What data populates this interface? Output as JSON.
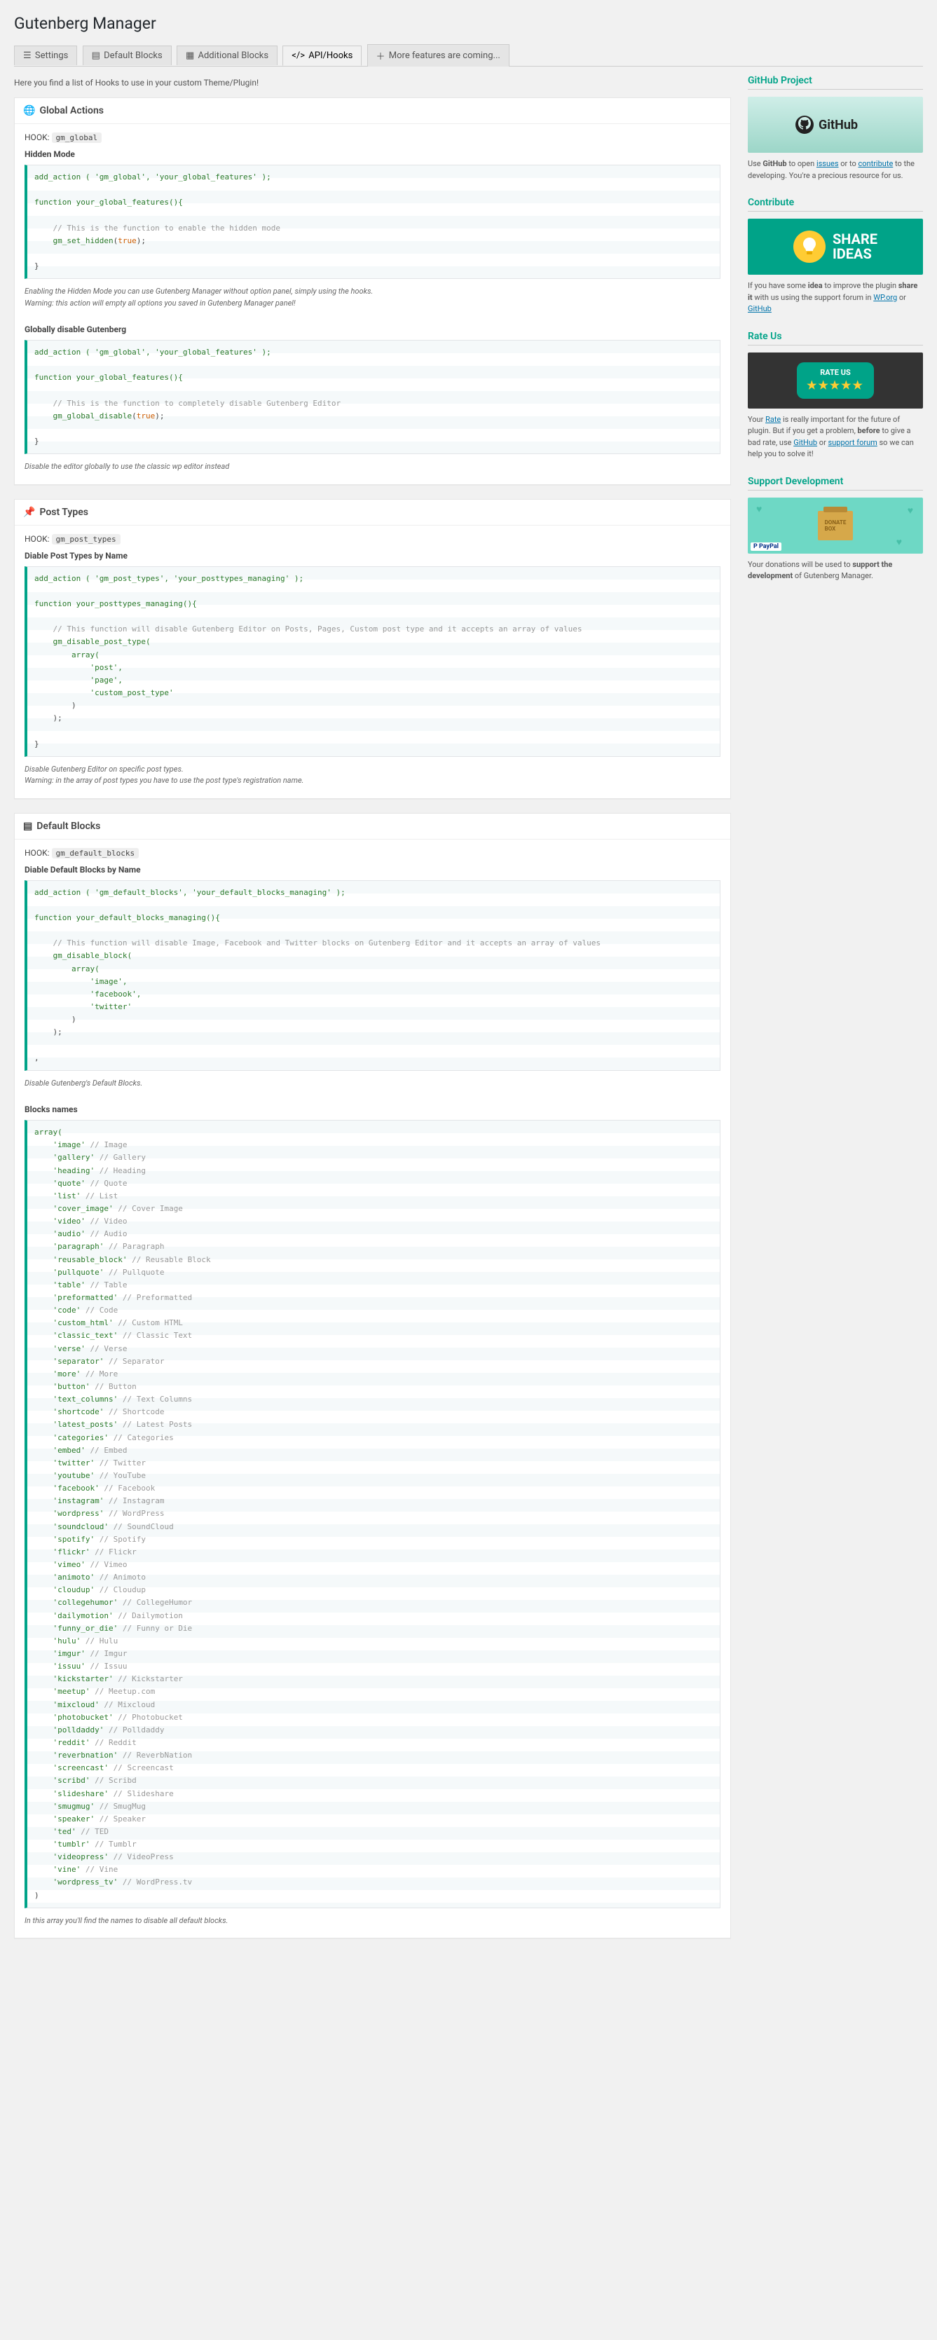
{
  "page": {
    "title": "Gutenberg Manager"
  },
  "tabs": [
    {
      "label": "Settings"
    },
    {
      "label": "Default Blocks"
    },
    {
      "label": "Additional Blocks"
    },
    {
      "label": "API/Hooks"
    },
    {
      "label": "More features are coming..."
    }
  ],
  "intro": "Here you find a list of Hooks to use in your custom Theme/Plugin!",
  "sections": {
    "global": {
      "heading": "Global Actions",
      "hook_prefix": "HOOK:",
      "hook": "gm_global",
      "sub1": "Hidden Mode",
      "note1a": "Enabling the Hidden Mode you can use Gutenberg Manager without option panel, simply using the hooks.",
      "note1b": "Warning: this action will empty all options you saved in Gutenberg Manager panel!",
      "sub2": "Globally disable Gutenberg",
      "note2": "Disable the editor globally to use the classic wp editor instead"
    },
    "post_types": {
      "heading": "Post Types",
      "hook_prefix": "HOOK:",
      "hook": "gm_post_types",
      "sub1": "Diable Post Types by Name",
      "note1a": "Disable Gutenberg Editor on specific post types.",
      "note1b": "Warning: in the array of post types you have to use the post type's registration name."
    },
    "default_blocks": {
      "heading": "Default Blocks",
      "hook_prefix": "HOOK:",
      "hook": "gm_default_blocks",
      "sub1": "Diable Default Blocks by Name",
      "note1": "Disable Gutenberg's Default Blocks.",
      "sub2": "Blocks names",
      "note2": "In this array you'll find the names to disable all default blocks."
    }
  },
  "code": {
    "global_hidden_add": "add_action ( 'gm_global', 'your_global_features' );",
    "global_hidden_fn_open": "function your_global_features(){",
    "global_hidden_cmt": "    // This is the function to enable the hidden mode",
    "global_hidden_call": "    gm_set_hidden(true);",
    "close_brace": "}",
    "global_disable_add": "add_action ( 'gm_global', 'your_global_features' );",
    "global_disable_fn_open": "function your_global_features(){",
    "global_disable_cmt": "    // This is the function to completely disable Gutenberg Editor",
    "global_disable_call": "    gm_global_disable(true);",
    "pt_add": "add_action ( 'gm_post_types', 'your_posttypes_managing' );",
    "pt_fn_open": "function your_posttypes_managing(){",
    "pt_cmt": "    // This function will disable Gutenberg Editor on Posts, Pages, Custom post type and it accepts an array of values",
    "pt_call_open": "    gm_disable_post_type(",
    "pt_array_open": "        array(",
    "pt_item1": "            'post',",
    "pt_item2": "            'page',",
    "pt_item3": "            'custom_post_type'",
    "pt_array_close": "        )",
    "pt_call_close": "    );",
    "db_add": "add_action ( 'gm_default_blocks', 'your_default_blocks_managing' );",
    "db_fn_open": "function your_default_blocks_managing(){",
    "db_cmt": "    // This function will disable Image, Facebook and Twitter blocks on Gutenberg Editor and it accepts an array of values",
    "db_call_open": "    gm_disable_block(",
    "db_array_open": "        array(",
    "db_item1": "            'image',",
    "db_item2": "            'facebook',",
    "db_item3": "            'twitter'",
    "db_array_close": "        )",
    "db_call_close": "    );",
    "db_trailing": ",",
    "bn_open": "array(",
    "bn_items": [
      [
        "'image'",
        "// Image"
      ],
      [
        "'gallery'",
        "// Gallery"
      ],
      [
        "'heading'",
        "// Heading"
      ],
      [
        "'quote'",
        "// Quote"
      ],
      [
        "'list'",
        "// List"
      ],
      [
        "'cover_image'",
        "// Cover Image"
      ],
      [
        "'video'",
        "// Video"
      ],
      [
        "'audio'",
        "// Audio"
      ],
      [
        "'paragraph'",
        "// Paragraph"
      ],
      [
        "'reusable_block'",
        "// Reusable Block"
      ],
      [
        "'pullquote'",
        "// Pullquote"
      ],
      [
        "'table'",
        "// Table"
      ],
      [
        "'preformatted'",
        "// Preformatted"
      ],
      [
        "'code'",
        "// Code"
      ],
      [
        "'custom_html'",
        "// Custom HTML"
      ],
      [
        "'classic_text'",
        "// Classic Text"
      ],
      [
        "'verse'",
        "// Verse"
      ],
      [
        "'separator'",
        "// Separator"
      ],
      [
        "'more'",
        "// More"
      ],
      [
        "'button'",
        "// Button"
      ],
      [
        "'text_columns'",
        "// Text Columns"
      ],
      [
        "'shortcode'",
        "// Shortcode"
      ],
      [
        "'latest_posts'",
        "// Latest Posts"
      ],
      [
        "'categories'",
        "// Categories"
      ],
      [
        "'embed'",
        "// Embed"
      ],
      [
        "'twitter'",
        "// Twitter"
      ],
      [
        "'youtube'",
        "// YouTube"
      ],
      [
        "'facebook'",
        "// Facebook"
      ],
      [
        "'instagram'",
        "// Instagram"
      ],
      [
        "'wordpress'",
        "// WordPress"
      ],
      [
        "'soundcloud'",
        "// SoundCloud"
      ],
      [
        "'spotify'",
        "// Spotify"
      ],
      [
        "'flickr'",
        "// Flickr"
      ],
      [
        "'vimeo'",
        "// Vimeo"
      ],
      [
        "'animoto'",
        "// Animoto"
      ],
      [
        "'cloudup'",
        "// Cloudup"
      ],
      [
        "'collegehumor'",
        "// CollegeHumor"
      ],
      [
        "'dailymotion'",
        "// Dailymotion"
      ],
      [
        "'funny_or_die'",
        "// Funny or Die"
      ],
      [
        "'hulu'",
        "// Hulu"
      ],
      [
        "'imgur'",
        "// Imgur"
      ],
      [
        "'issuu'",
        "// Issuu"
      ],
      [
        "'kickstarter'",
        "// Kickstarter"
      ],
      [
        "'meetup'",
        "// Meetup.com"
      ],
      [
        "'mixcloud'",
        "// Mixcloud"
      ],
      [
        "'photobucket'",
        "// Photobucket"
      ],
      [
        "'polldaddy'",
        "// Polldaddy"
      ],
      [
        "'reddit'",
        "// Reddit"
      ],
      [
        "'reverbnation'",
        "// ReverbNation"
      ],
      [
        "'screencast'",
        "// Screencast"
      ],
      [
        "'scribd'",
        "// Scribd"
      ],
      [
        "'slideshare'",
        "// Slideshare"
      ],
      [
        "'smugmug'",
        "// SmugMug"
      ],
      [
        "'speaker'",
        "// Speaker"
      ],
      [
        "'ted'",
        "// TED"
      ],
      [
        "'tumblr'",
        "// Tumblr"
      ],
      [
        "'videopress'",
        "// VideoPress"
      ],
      [
        "'vine'",
        "// Vine"
      ],
      [
        "'wordpress_tv'",
        "// WordPress.tv"
      ]
    ],
    "bn_close": ")"
  },
  "sidebar": {
    "github": {
      "heading": "GitHub Project",
      "logo": "GitHub",
      "text1": "Use ",
      "bold1": "GitHub",
      "text2": " to open ",
      "link1": "issues",
      "text3": " or to ",
      "link2": "contribute",
      "text4": " to the developing. You're a precious resource for us."
    },
    "contribute": {
      "heading": "Contribute",
      "share1": "SHARE",
      "share2": "IDEAS",
      "text1": "If you have some ",
      "bold1": "idea",
      "text2": " to improve the plugin ",
      "bold2": "share it",
      "text3": " with us using the support forum in ",
      "link1": "WP.org",
      "text4": " or ",
      "link2": "GitHub"
    },
    "rate": {
      "heading": "Rate Us",
      "title": "RATE US",
      "stars": "★★★★★",
      "text1": "Your ",
      "link1": "Rate",
      "text2": " is really important for the future of plugin. But if you get a problem, ",
      "bold1": "before",
      "text3": " to give a bad rate, use ",
      "link2": "GitHub",
      "text4": " or ",
      "link3": "support forum",
      "text5": " so we can help you to solve it!"
    },
    "support": {
      "heading": "Support Development",
      "box": "DONATE BOX",
      "pp": "P PayPal",
      "text1": "Your donations will be used to ",
      "bold1": "support the development",
      "text2": " of Gutenberg Manager."
    }
  }
}
